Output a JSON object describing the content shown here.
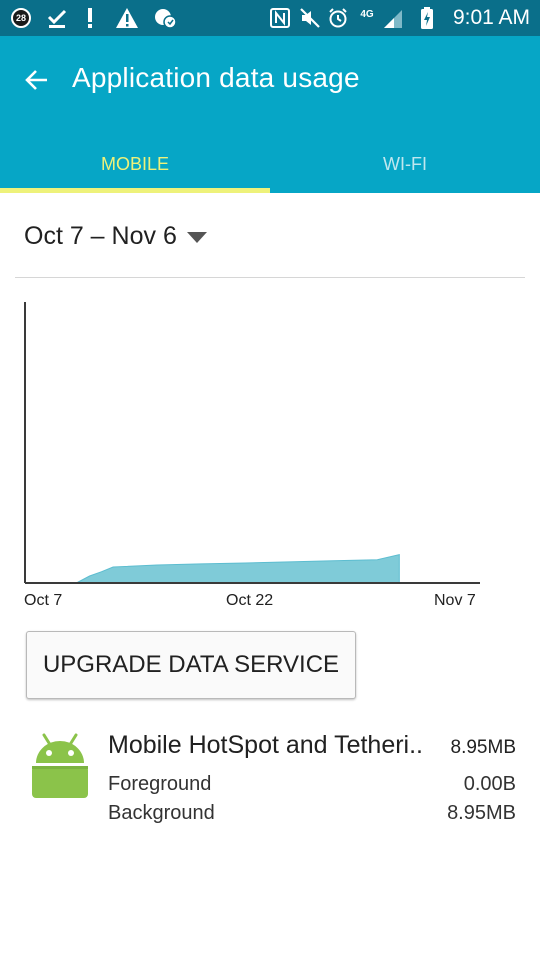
{
  "status_bar": {
    "notification_count": "28",
    "time": "9:01 AM",
    "network_type": "4G"
  },
  "app_bar": {
    "title": "Application data usage"
  },
  "tabs": [
    {
      "label": "MOBILE",
      "selected": true
    },
    {
      "label": "WI-FI",
      "selected": false
    }
  ],
  "date_range": {
    "label": "Oct 7 – Nov 6"
  },
  "chart_data": {
    "type": "area",
    "x_tick_labels": [
      "Oct 7",
      "Oct 22",
      "Nov 7"
    ],
    "xlabel": "",
    "ylabel": "",
    "x_range_days": [
      0,
      31
    ],
    "y_range_fraction": [
      0,
      1
    ],
    "series": [
      {
        "x": [
          3.5,
          4.4,
          5.2,
          6.0,
          9,
          12,
          15,
          18,
          21,
          24,
          25.5
        ],
        "y": [
          0.0,
          0.025,
          0.04,
          0.057,
          0.064,
          0.068,
          0.071,
          0.075,
          0.079,
          0.083,
          0.101
        ]
      }
    ],
    "colors": {
      "fill": "#7fcbd8",
      "stroke": "#5dbdd0",
      "axis": "#3a3a3a"
    },
    "grid": false
  },
  "upgrade_button": {
    "label": "UPGRADE DATA SERVICE"
  },
  "app_usage": [
    {
      "icon": "android-robot-icon",
      "name": "Mobile HotSpot and Tetheri..",
      "total": "8.95MB",
      "foreground_label": "Foreground",
      "foreground_value": "0.00B",
      "background_label": "Background",
      "background_value": "8.95MB"
    }
  ]
}
